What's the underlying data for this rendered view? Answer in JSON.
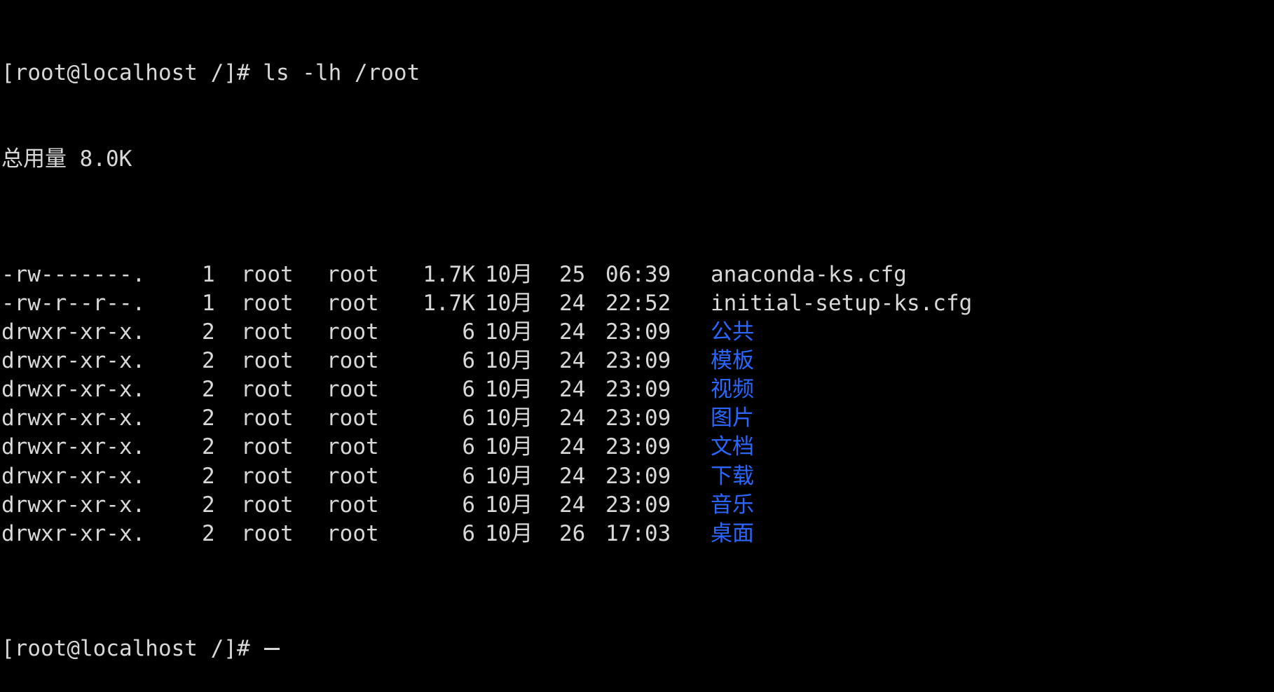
{
  "terminal": {
    "prompt": "[root@localhost /]# ",
    "command": "ls -lh /root",
    "total_line": "总用量 8.0K",
    "colors": {
      "background": "#000000",
      "text": "#d8d8d8",
      "directory": "#2b66ff"
    },
    "entries": [
      {
        "perm": "-rw-------.",
        "links": "1",
        "owner": "root",
        "group": "root",
        "size": "1.7K",
        "month": "10月",
        "day": "25",
        "time": "06:39",
        "name": "anaconda-ks.cfg",
        "is_dir": false
      },
      {
        "perm": "-rw-r--r--.",
        "links": "1",
        "owner": "root",
        "group": "root",
        "size": "1.7K",
        "month": "10月",
        "day": "24",
        "time": "22:52",
        "name": "initial-setup-ks.cfg",
        "is_dir": false
      },
      {
        "perm": "drwxr-xr-x.",
        "links": "2",
        "owner": "root",
        "group": "root",
        "size": "6",
        "month": "10月",
        "day": "24",
        "time": "23:09",
        "name": "公共",
        "is_dir": true
      },
      {
        "perm": "drwxr-xr-x.",
        "links": "2",
        "owner": "root",
        "group": "root",
        "size": "6",
        "month": "10月",
        "day": "24",
        "time": "23:09",
        "name": "模板",
        "is_dir": true
      },
      {
        "perm": "drwxr-xr-x.",
        "links": "2",
        "owner": "root",
        "group": "root",
        "size": "6",
        "month": "10月",
        "day": "24",
        "time": "23:09",
        "name": "视频",
        "is_dir": true
      },
      {
        "perm": "drwxr-xr-x.",
        "links": "2",
        "owner": "root",
        "group": "root",
        "size": "6",
        "month": "10月",
        "day": "24",
        "time": "23:09",
        "name": "图片",
        "is_dir": true
      },
      {
        "perm": "drwxr-xr-x.",
        "links": "2",
        "owner": "root",
        "group": "root",
        "size": "6",
        "month": "10月",
        "day": "24",
        "time": "23:09",
        "name": "文档",
        "is_dir": true
      },
      {
        "perm": "drwxr-xr-x.",
        "links": "2",
        "owner": "root",
        "group": "root",
        "size": "6",
        "month": "10月",
        "day": "24",
        "time": "23:09",
        "name": "下载",
        "is_dir": true
      },
      {
        "perm": "drwxr-xr-x.",
        "links": "2",
        "owner": "root",
        "group": "root",
        "size": "6",
        "month": "10月",
        "day": "24",
        "time": "23:09",
        "name": "音乐",
        "is_dir": true
      },
      {
        "perm": "drwxr-xr-x.",
        "links": "2",
        "owner": "root",
        "group": "root",
        "size": "6",
        "month": "10月",
        "day": "26",
        "time": "17:03",
        "name": "桌面",
        "is_dir": true
      }
    ],
    "final_prompt": "[root@localhost /]# "
  }
}
